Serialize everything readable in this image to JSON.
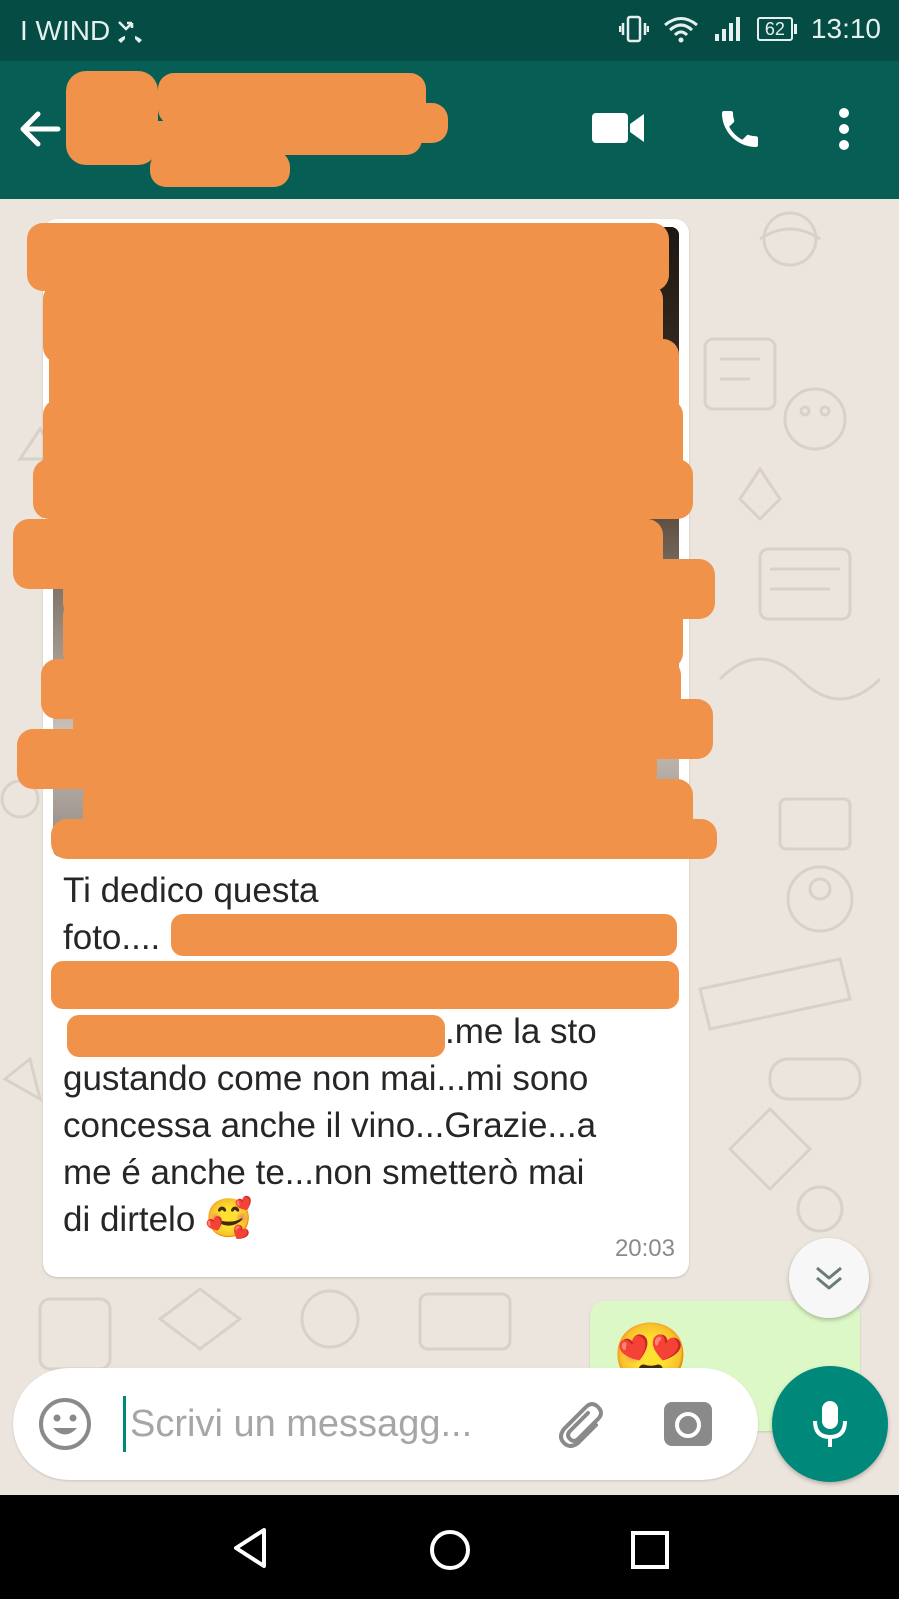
{
  "status_bar": {
    "carrier": "I WIND",
    "battery": "62",
    "time": "13:10"
  },
  "header": {
    "back_icon": "arrow-left-icon",
    "video_call_icon": "videocam-icon",
    "voice_call_icon": "phone-icon",
    "menu_icon": "more-vert-icon"
  },
  "incoming_message": {
    "text_lines": [
      "Ti dedico questa",
      "foto....",
      "",
      ".me la sto",
      "gustando come non mai...mi sono",
      "concessa anche il vino...Grazie...a",
      "me é anche te...non smetterò mai",
      "di dirtelo"
    ],
    "emoji": "🥰",
    "time": "20:03"
  },
  "outgoing_message": {
    "emoji": "😍"
  },
  "composer": {
    "placeholder": "Scrivi un messagg...",
    "emoji_icon": "smiley-icon",
    "attach_icon": "paperclip-icon",
    "camera_icon": "camera-icon",
    "mic_icon": "mic-icon"
  },
  "colors": {
    "header": "#075e54",
    "status_bar": "#054d44",
    "accent": "#00897b",
    "outgoing_bubble": "#dcf8c6",
    "redaction": "#f0924a"
  }
}
